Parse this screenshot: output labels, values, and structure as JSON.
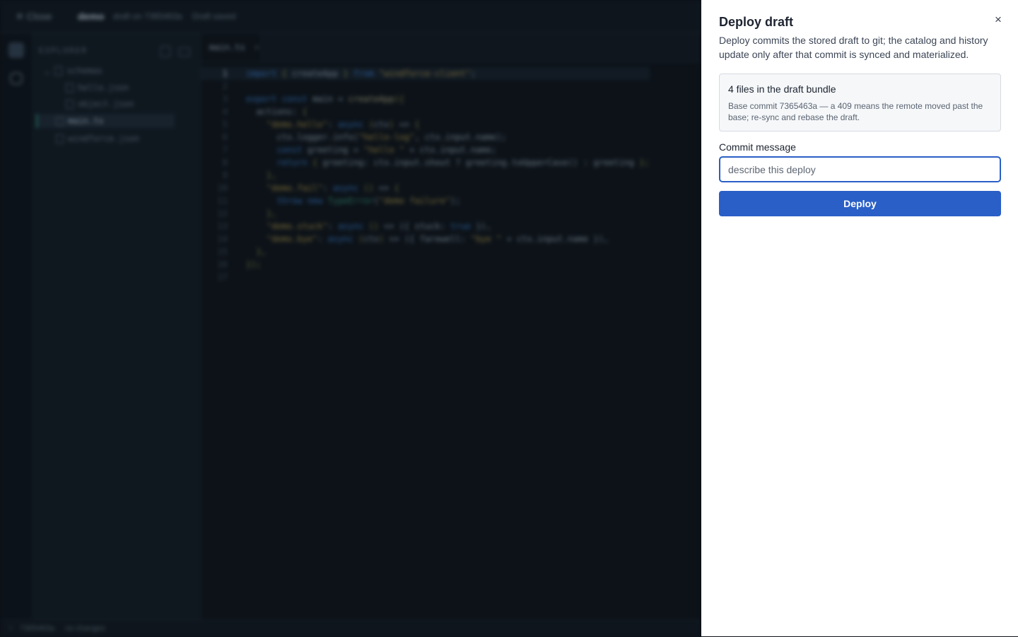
{
  "topbar": {
    "close_label": "✕  Close",
    "title": "demo",
    "draft_meta": "draft on 7365463a",
    "save_status": "Draft saved"
  },
  "explorer": {
    "heading": "EXPLORER",
    "items": [
      {
        "label": "schemas",
        "type": "folder"
      },
      {
        "label": "hello.json",
        "type": "file"
      },
      {
        "label": "object.json",
        "type": "file"
      },
      {
        "label": "main.ts",
        "type": "file",
        "selected": true
      },
      {
        "label": "windforce.json",
        "type": "file"
      }
    ]
  },
  "editor": {
    "tab_label": "main.ts",
    "tab_close": "×",
    "line_numbers": [
      "1",
      "2",
      "3",
      "4",
      "5",
      "6",
      "7",
      "8",
      "9",
      "10",
      "11",
      "12",
      "13",
      "14",
      "15",
      "16",
      "17"
    ]
  },
  "statusbar": {
    "commit": "7365463a",
    "changes": "no changes"
  },
  "drawer": {
    "title": "Deploy draft",
    "close_icon": "×",
    "description": "Deploy commits the stored draft to git; the catalog and history update only after that commit is synced and materialized.",
    "bundle": {
      "title": "4 files in the draft bundle",
      "body": "Base commit 7365463a — a 409 means the remote moved past the base; re-sync and rebase the draft."
    },
    "commit_label": "Commit message",
    "commit_value": "",
    "commit_placeholder": "describe this deploy",
    "deploy_label": "Deploy"
  }
}
